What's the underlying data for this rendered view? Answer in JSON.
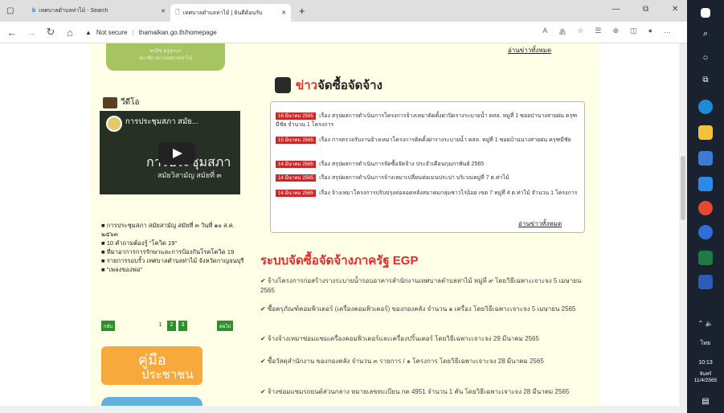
{
  "browser": {
    "tabs": [
      {
        "title": "เทศบาลตำบลท่าไม้ - Search"
      },
      {
        "title": "เทศบาลตำบลท่าไม้ | ยินดีต้อนรับ"
      }
    ],
    "new_tab": "+",
    "security": "Not secure",
    "url": "thamaikan.go.th/homepage",
    "window": {
      "minimize": "—",
      "maximize": "⧉",
      "close": "✕"
    }
  },
  "left": {
    "green_text": [
      "พรมิ่ช  ครูสุกแก่",
      "สมาชิก สภาเทศบาลท่าไม้"
    ],
    "video_heading": "วีดีโอ",
    "video_title": "การประชุมสภา สมัย...",
    "video_overlay_1": "การประชุมสภา",
    "video_overlay_2": "สมัยวิสามัญ สมัยที่ ๓",
    "video_list": [
      "การประชุมสภา สมัยสามัญ สมัยที่ ๓ วันที่ ๑๐ ส.ค. ๒๕๖๓",
      "10 คำถามต้องรู้ \"โควิด 19\"",
      "ที่มาอาการการรักษาและการป้องกันโรคโควิด 19",
      "รายการรอบรั้ว เทศบาลตำบลท่าไม้ จังหวัดกาญจนบุรี",
      "\"เพลงของพ่อ\""
    ],
    "pager": {
      "prev": "กลับ",
      "pages": [
        "1",
        "2",
        "3"
      ],
      "next": "ต่อไป"
    },
    "banner": {
      "line1": "คู่มือ",
      "line2": "ประชาชน"
    }
  },
  "right": {
    "more_top": "อ่านข่าวทั้งหมด",
    "heading_red": "ข่าว",
    "heading_black": "จัดซื้อจัดจ้าง",
    "news": [
      {
        "date": "16 มีนาคม 2565",
        "text": "เรื่อง สรุปผลการดำเนินการโครงการจ้างเหมาติดตั้งฝาปิดรางระบายน้ำ คสล. หมู่ที่ 1 ซอยป่านางสายฝน ครุฑมีชัย จำนวน 1 โครงการ"
      },
      {
        "date": "15 มีนาคม 2565",
        "text": "เรื่อง การตรวจรับงานจ้างเหมาโครงการติดตั้งฝารางระบายน้ำ คสล. หมู่ที่ 1 ซอยบ้านนางสายฝน ครุฑมีชัย"
      },
      {
        "date": "14 มีนาคม 2565",
        "text": "เรื่อง สรุปผลการดำเนินการจัดซื้อจัดจ้าง ประจำเดือนกุมภาพันธ์ 2565"
      },
      {
        "date": "14 มีนาคม 2565",
        "text": "เรื่อง สรุปผลการดำเนินการจ้างเหมาเปลี่ยนท่อเมนประปา บริเวณหมู่ที่ 7 ต.ท่าไม้"
      },
      {
        "date": "14 มีนาคม 2565",
        "text": "เรื่อง จ้างเหมาโครงการปรับปรุงท่อลอดหลังสมาคมกลุ่มชาวไร่อ้อย เขต 7 หมู่ที่ 4 ต.ท่าไม้ จำนวน 1 โครงการ"
      }
    ],
    "more_news": "อ่านข่าวทั้งหมด",
    "egp_heading": "ระบบจัดซื้อจัดจ้างภาครัฐ EGP",
    "egp": [
      "✔ จ้างโครงการก่อสร้างรางระบายน้ำรอบอาคารสำนักงานเทศบาลตำบลท่าไม้ หมู่ที่ ๙ โดยวิธีเฉพาะเจาะจง 5 เมษายน 2565",
      "✔ ซื้อครุภัณฑ์คอมพิวเตอร์ (เครื่องคอมพิวเตอร์) ของกองคลัง จำนวน ๑ เครื่อง โดยวิธีเฉพาะเจาะจง 5 เมษายน 2565",
      "✔ จ้างจ้างเหมาซ่อมแซมเครื่องคอมพิวเตอร์และเครื่องปริ้นเตอร์ โดยวิธีเฉพาะเจาะจง 29 มีนาคม 2565",
      "✔ ซื้อวัสดุสำนักงาน ของกองคลัง จำนวน ๓ รายการ / ๑ โครงการ โดยวิธีเฉพาะเจาะจง 28 มีนาคม 2565",
      "✔ จ้างซ่อมแซมรถยนต์ส่วนกลาง หมายเลขทะเบียน กต 4951 จำนวน 1 คัน โดยวิธีเฉพาะเจาะจง 28 มีนาคม 2565"
    ]
  },
  "taskbar": {
    "lang": "ไทย",
    "time": "10:13",
    "day": "จันทร์",
    "date": "11/4/2565"
  }
}
